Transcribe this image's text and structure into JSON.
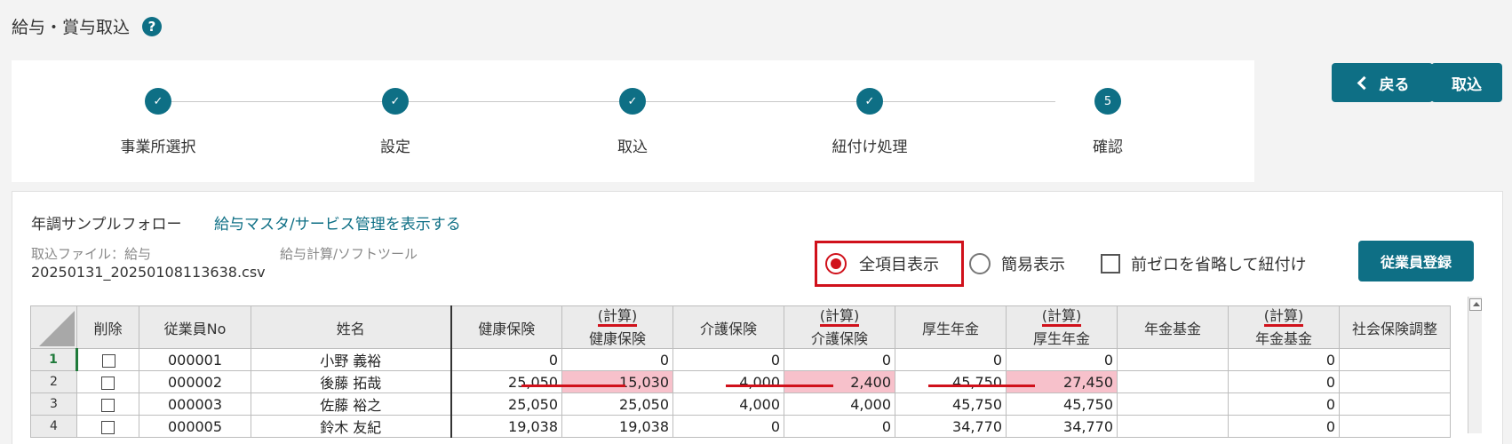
{
  "header": {
    "title": "給与・賞与取込",
    "help_icon": "?"
  },
  "steps": [
    {
      "label": "事業所選択",
      "state": "done",
      "mark": "✓"
    },
    {
      "label": "設定",
      "state": "done",
      "mark": "✓"
    },
    {
      "label": "取込",
      "state": "done",
      "mark": "✓"
    },
    {
      "label": "紐付け処理",
      "state": "done",
      "mark": "✓"
    },
    {
      "label": "確認",
      "state": "current",
      "mark": "5"
    }
  ],
  "actions": {
    "back_label": "戻る",
    "import_label": "取込",
    "register_label": "従業員登録"
  },
  "info": {
    "company": "年調サンプルフォロー",
    "link": "給与マスタ/サービス管理を表示する",
    "file_label": "取込ファイル：給与",
    "tool_label": "給与計算/ソフトツール",
    "filename": "20250131_20250108113638.csv"
  },
  "options": {
    "all_items": "全項目表示",
    "simple": "簡易表示",
    "omit_zero": "前ゼロを省略して紐付け",
    "selected": "all_items"
  },
  "table": {
    "headers": {
      "delete": "削除",
      "emp_no": "従業員No",
      "name": "姓名",
      "health": "健康保険",
      "calc_prefix": "(計算)",
      "calc_health": "健康保険",
      "care": "介護保険",
      "calc_care": "介護保険",
      "pension": "厚生年金",
      "calc_pension": "厚生年金",
      "fund": "年金基金",
      "calc_fund": "年金基金",
      "adjust": "社会保険調整"
    },
    "rows": [
      {
        "n": "1",
        "emp_no": "000001",
        "name": "小野 義裕",
        "health": "0",
        "calc_health": "0",
        "care": "0",
        "calc_care": "0",
        "pension": "0",
        "calc_pension": "0",
        "fund": "",
        "calc_fund": "0",
        "adjust": ""
      },
      {
        "n": "2",
        "emp_no": "000002",
        "name": "後藤 拓哉",
        "health": "25,050",
        "calc_health": "15,030",
        "care": "4,000",
        "calc_care": "2,400",
        "pension": "45,750",
        "calc_pension": "27,450",
        "fund": "",
        "calc_fund": "0",
        "adjust": ""
      },
      {
        "n": "3",
        "emp_no": "000003",
        "name": "佐藤 裕之",
        "health": "25,050",
        "calc_health": "25,050",
        "care": "4,000",
        "calc_care": "4,000",
        "pension": "45,750",
        "calc_pension": "45,750",
        "fund": "",
        "calc_fund": "0",
        "adjust": ""
      },
      {
        "n": "4",
        "emp_no": "000005",
        "name": "鈴木 友紀",
        "health": "19,038",
        "calc_health": "19,038",
        "care": "0",
        "calc_care": "0",
        "pension": "34,770",
        "calc_pension": "34,770",
        "fund": "",
        "calc_fund": "0",
        "adjust": ""
      }
    ],
    "highlight_row": 1
  }
}
